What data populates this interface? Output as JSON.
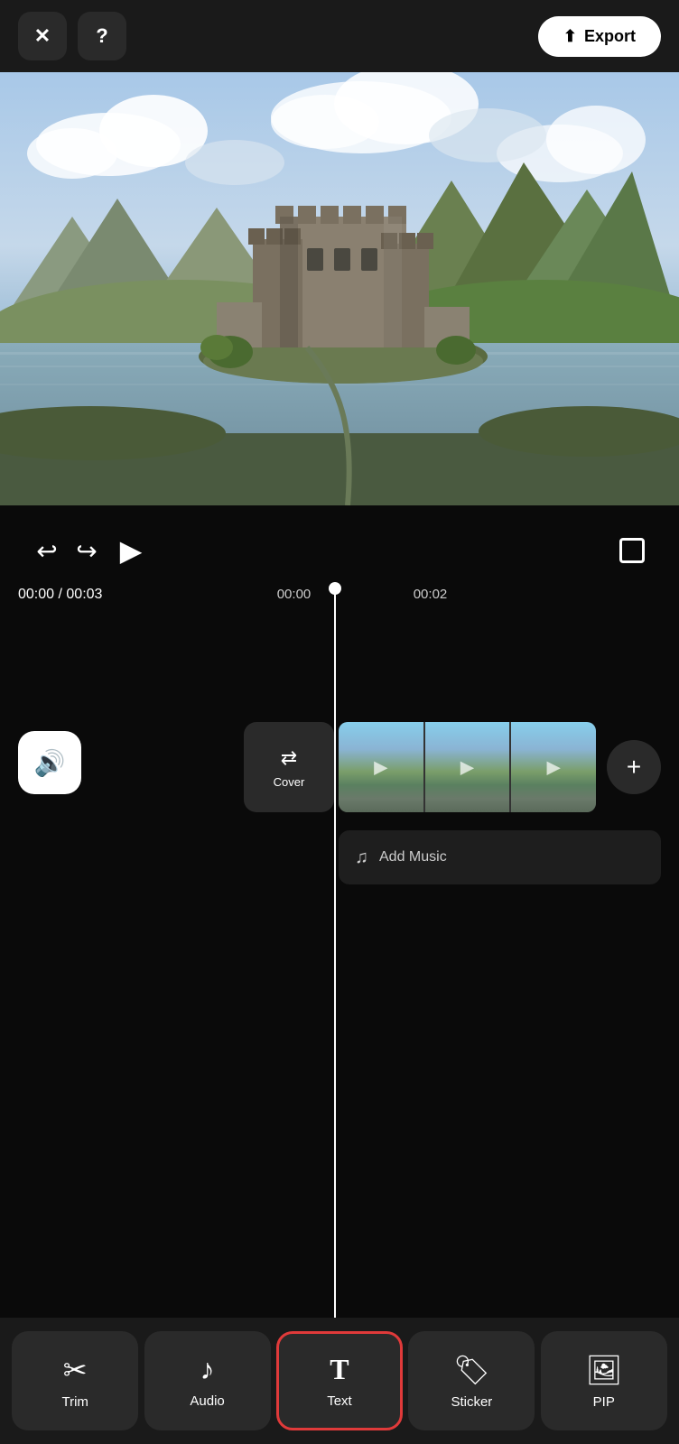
{
  "topbar": {
    "close_label": "✕",
    "help_label": "?",
    "export_label": "Export"
  },
  "playback": {
    "time_current": "00:00",
    "time_total": "00:03",
    "time_separator": "/",
    "timeline_mark1": "00:00",
    "timeline_mark2": "00:02",
    "undo_icon": "↩",
    "redo_icon": "↪",
    "play_icon": "▶"
  },
  "timeline": {
    "cover_label": "Cover",
    "add_music_label": "Add Music",
    "add_clip_icon": "+"
  },
  "toolbar": {
    "items": [
      {
        "id": "trim",
        "label": "Trim",
        "icon": "scissors"
      },
      {
        "id": "audio",
        "label": "Audio",
        "icon": "audio"
      },
      {
        "id": "text",
        "label": "Text",
        "icon": "text",
        "active": true
      },
      {
        "id": "sticker",
        "label": "Sticker",
        "icon": "sticker"
      },
      {
        "id": "pip",
        "label": "PIP",
        "icon": "pip"
      }
    ]
  },
  "colors": {
    "active_border": "#e03a3a",
    "background": "#000000",
    "toolbar_bg": "#1a1a1a",
    "item_bg": "#2a2a2a"
  }
}
